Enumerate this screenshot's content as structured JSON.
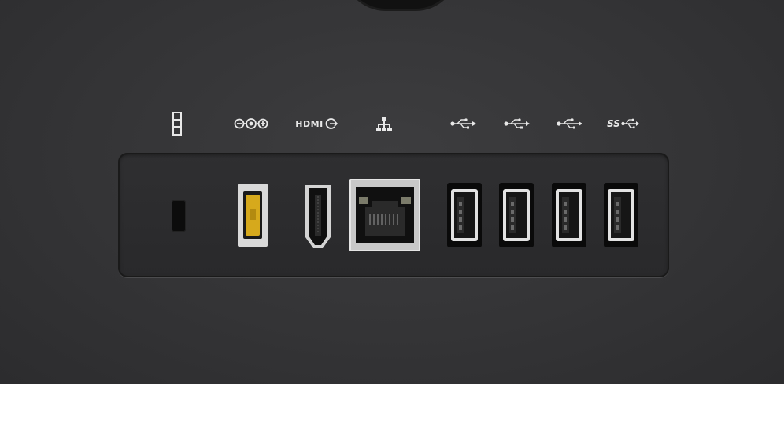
{
  "scene": {
    "description_colors": {
      "chassis": "#343436",
      "panel": "#2c2c2e",
      "icon": "#e8e8e8",
      "dc_connector": "#d6a91c"
    }
  },
  "labels": {
    "lock": {
      "icon": "lock-slot-icon"
    },
    "dc_in": {
      "icon": "dc-power-icon"
    },
    "hdmi": {
      "text": "HDMI",
      "icon": "hdmi-out-icon"
    },
    "ethernet": {
      "icon": "ethernet-icon"
    },
    "usb1": {
      "icon": "usb-icon"
    },
    "usb2": {
      "icon": "usb-icon"
    },
    "usb3": {
      "icon": "usb-icon"
    },
    "usb_ss": {
      "text": "SS",
      "icon": "usb-superspeed-icon"
    }
  }
}
